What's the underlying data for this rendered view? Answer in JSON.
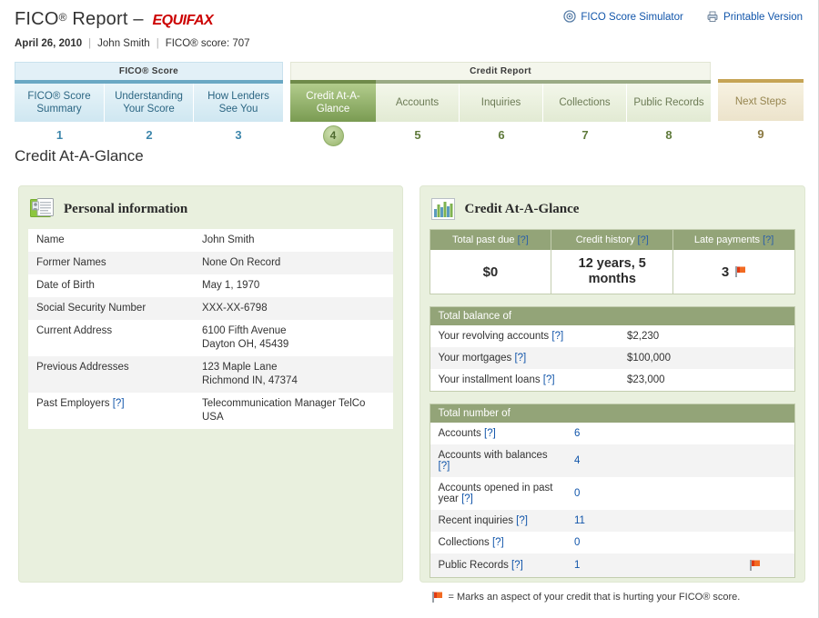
{
  "header": {
    "title_prefix": "FICO",
    "title_reg": "®",
    "title_mid": " Report – ",
    "brand": "EQUIFAX",
    "date": "April 26, 2010",
    "user": "John Smith",
    "score_label": "FICO® score: 707",
    "links": [
      {
        "label": "FICO Score Simulator",
        "icon": "simulator-icon"
      },
      {
        "label": "Printable Version",
        "icon": "printer-icon"
      }
    ]
  },
  "nav": {
    "groups": [
      {
        "label": "FICO® Score",
        "style": "blue"
      },
      {
        "label": "Credit Report",
        "style": "green"
      },
      {
        "label": "",
        "style": "tan"
      }
    ],
    "tabs": [
      {
        "label": "FICO® Score Summary",
        "num": "1",
        "style": "blue",
        "active": false
      },
      {
        "label": "Understanding Your Score",
        "num": "2",
        "style": "blue",
        "active": false
      },
      {
        "label": "How Lenders See You",
        "num": "3",
        "style": "blue",
        "active": false
      },
      {
        "label": "Credit At-A-Glance",
        "num": "4",
        "style": "green",
        "active": true
      },
      {
        "label": "Accounts",
        "num": "5",
        "style": "green",
        "active": false
      },
      {
        "label": "Inquiries",
        "num": "6",
        "style": "green",
        "active": false
      },
      {
        "label": "Collections",
        "num": "7",
        "style": "green",
        "active": false
      },
      {
        "label": "Public Records",
        "num": "8",
        "style": "green",
        "active": false
      },
      {
        "label": "Next Steps",
        "num": "9",
        "style": "tan",
        "active": false
      }
    ]
  },
  "page": {
    "title": "Credit At-A-Glance"
  },
  "personal": {
    "panel_title": "Personal information",
    "icon": "id-card-icon",
    "rows": [
      {
        "key": "Name",
        "value": "John Smith",
        "help": false
      },
      {
        "key": "Former Names",
        "value": "None On Record",
        "help": false
      },
      {
        "key": "Date of Birth",
        "value": "May 1, 1970",
        "help": false
      },
      {
        "key": "Social Security Number",
        "value": "XXX-XX-6798",
        "help": false
      },
      {
        "key": "Current Address",
        "value": "6100 Fifth Avenue\nDayton OH, 45439",
        "help": false
      },
      {
        "key": "Previous Addresses",
        "value": "123 Maple Lane\nRichmond IN, 47374",
        "help": false
      },
      {
        "key": "Past Employers",
        "value": "Telecommunication Manager TelCo USA",
        "help": true
      }
    ]
  },
  "glance": {
    "panel_title": "Credit At-A-Glance",
    "icon": "bar-chart-icon",
    "help_marker": "[?]",
    "summary": [
      {
        "head": "Total past due",
        "help": "[?]",
        "value": "$0",
        "flag": false
      },
      {
        "head": "Credit history",
        "help": "[?]",
        "value": "12 years, 5 months",
        "flag": false
      },
      {
        "head": "Late payments",
        "help": "[?]",
        "value": "3",
        "flag": true
      }
    ],
    "balance_section": {
      "title": "Total balance of",
      "rows": [
        {
          "label": "Your revolving accounts",
          "help": "[?]",
          "value": "$2,230",
          "link": false,
          "flag": false
        },
        {
          "label": "Your mortgages",
          "help": "[?]",
          "value": "$100,000",
          "link": false,
          "flag": false
        },
        {
          "label": "Your installment loans",
          "help": "[?]",
          "value": "$23,000",
          "link": false,
          "flag": false
        }
      ]
    },
    "count_section": {
      "title": "Total number of",
      "rows": [
        {
          "label": "Accounts",
          "help": "[?]",
          "value": "6",
          "link": true,
          "flag": false
        },
        {
          "label": "Accounts with balances",
          "help": "[?]",
          "value": "4",
          "link": true,
          "flag": false
        },
        {
          "label": "Accounts opened in past year",
          "help": "[?]",
          "value": "0",
          "link": true,
          "flag": false
        },
        {
          "label": "Recent inquiries",
          "help": "[?]",
          "value": "11",
          "link": true,
          "flag": false
        },
        {
          "label": "Collections",
          "help": "[?]",
          "value": "0",
          "link": true,
          "flag": false
        },
        {
          "label": "Public Records",
          "help": "[?]",
          "value": "1",
          "link": true,
          "flag": true
        }
      ]
    },
    "footnote": "= Marks an aspect of your credit that is hurting your FICO® score."
  },
  "colors": {
    "brand_red": "#cc0000",
    "link_blue": "#1155aa",
    "active_tab_green": "#7a9b52",
    "section_head_green": "#93a478",
    "panel_bg": "#e9f0de",
    "flag_orange": "#f26a22"
  }
}
